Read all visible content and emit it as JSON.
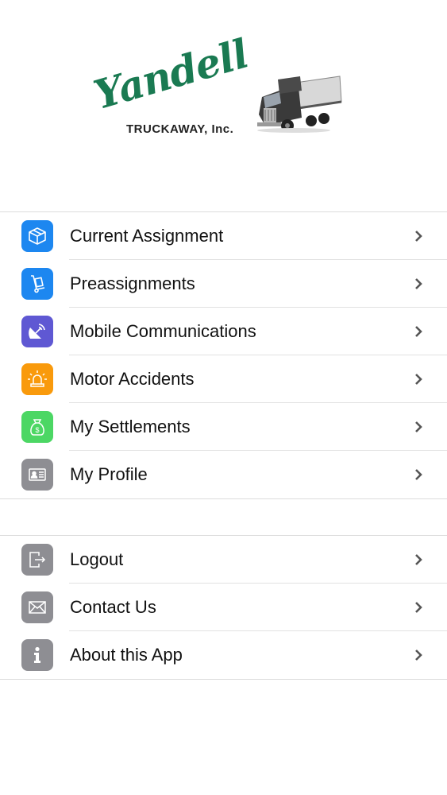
{
  "header": {
    "logo_script": "Yandell",
    "logo_subtitle": "TRUCKAWAY, Inc."
  },
  "menu": {
    "main": [
      {
        "label": "Current Assignment",
        "icon": "box-icon",
        "color": "#1d87f0"
      },
      {
        "label": "Preassignments",
        "icon": "hand-truck-icon",
        "color": "#1d87f0"
      },
      {
        "label": "Mobile Communications",
        "icon": "satellite-dish-icon",
        "color": "#5f58d3"
      },
      {
        "label": "Motor Accidents",
        "icon": "siren-icon",
        "color": "#f99a0c"
      },
      {
        "label": "My Settlements",
        "icon": "money-bag-icon",
        "color": "#4cd764"
      },
      {
        "label": "My Profile",
        "icon": "id-card-icon",
        "color": "#8e8e93"
      }
    ],
    "secondary": [
      {
        "label": "Logout",
        "icon": "logout-icon",
        "color": "#8e8e93"
      },
      {
        "label": "Contact Us",
        "icon": "envelope-icon",
        "color": "#8e8e93"
      },
      {
        "label": "About this App",
        "icon": "info-icon",
        "color": "#8e8e93"
      }
    ]
  }
}
